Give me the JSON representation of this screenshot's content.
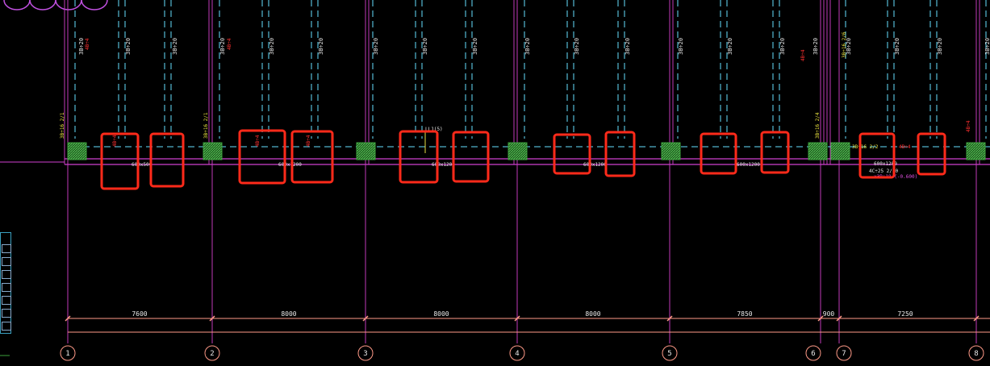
{
  "colors": {
    "background": "#000000",
    "beam_line": "#d040d0",
    "column_grid": "#c03ab8",
    "dashed_rebar": "#66e0ff",
    "highlight_box": "#ff2a1a",
    "column_fill": "#2e8b2e",
    "dimension_line": "#ff9a88",
    "axis_bubble": "#ff9a88",
    "text_white": "#e8e8e8",
    "text_red": "#ff3030",
    "text_yellow": "#e8e040",
    "text_magenta": "#e050e0"
  },
  "axes": [
    {
      "label": "1"
    },
    {
      "label": "2"
    },
    {
      "label": "3"
    },
    {
      "label": "4"
    },
    {
      "label": "5"
    },
    {
      "label": "6"
    },
    {
      "label": "7"
    },
    {
      "label": "8"
    }
  ],
  "dimensions": [
    "7600",
    "8000",
    "8000",
    "8000",
    "7850",
    "900",
    "7250"
  ],
  "beam_labels": [
    "600x500",
    "600x1200",
    "600x1200",
    "600x1200",
    "600x1200",
    "600x1200"
  ],
  "rebar_labels": {
    "secondary": "3B÷20",
    "main": "3B÷20",
    "side": "3B÷20"
  },
  "side_labels": [
    "3B÷16 2/1",
    "3B÷16 2/1",
    "3B÷16 2/4",
    "3B÷16 2/6",
    "3B÷16 2/2"
  ],
  "red_notes": [
    "4B÷4",
    "4B÷4",
    "4B÷4",
    "4B÷4",
    "4B÷4"
  ],
  "misc_notes": {
    "beam_tag": "LL1(5)",
    "bottom_note": "4C÷25 2/10",
    "bottom_note_2": "x3B÷18 (-0.600)"
  }
}
